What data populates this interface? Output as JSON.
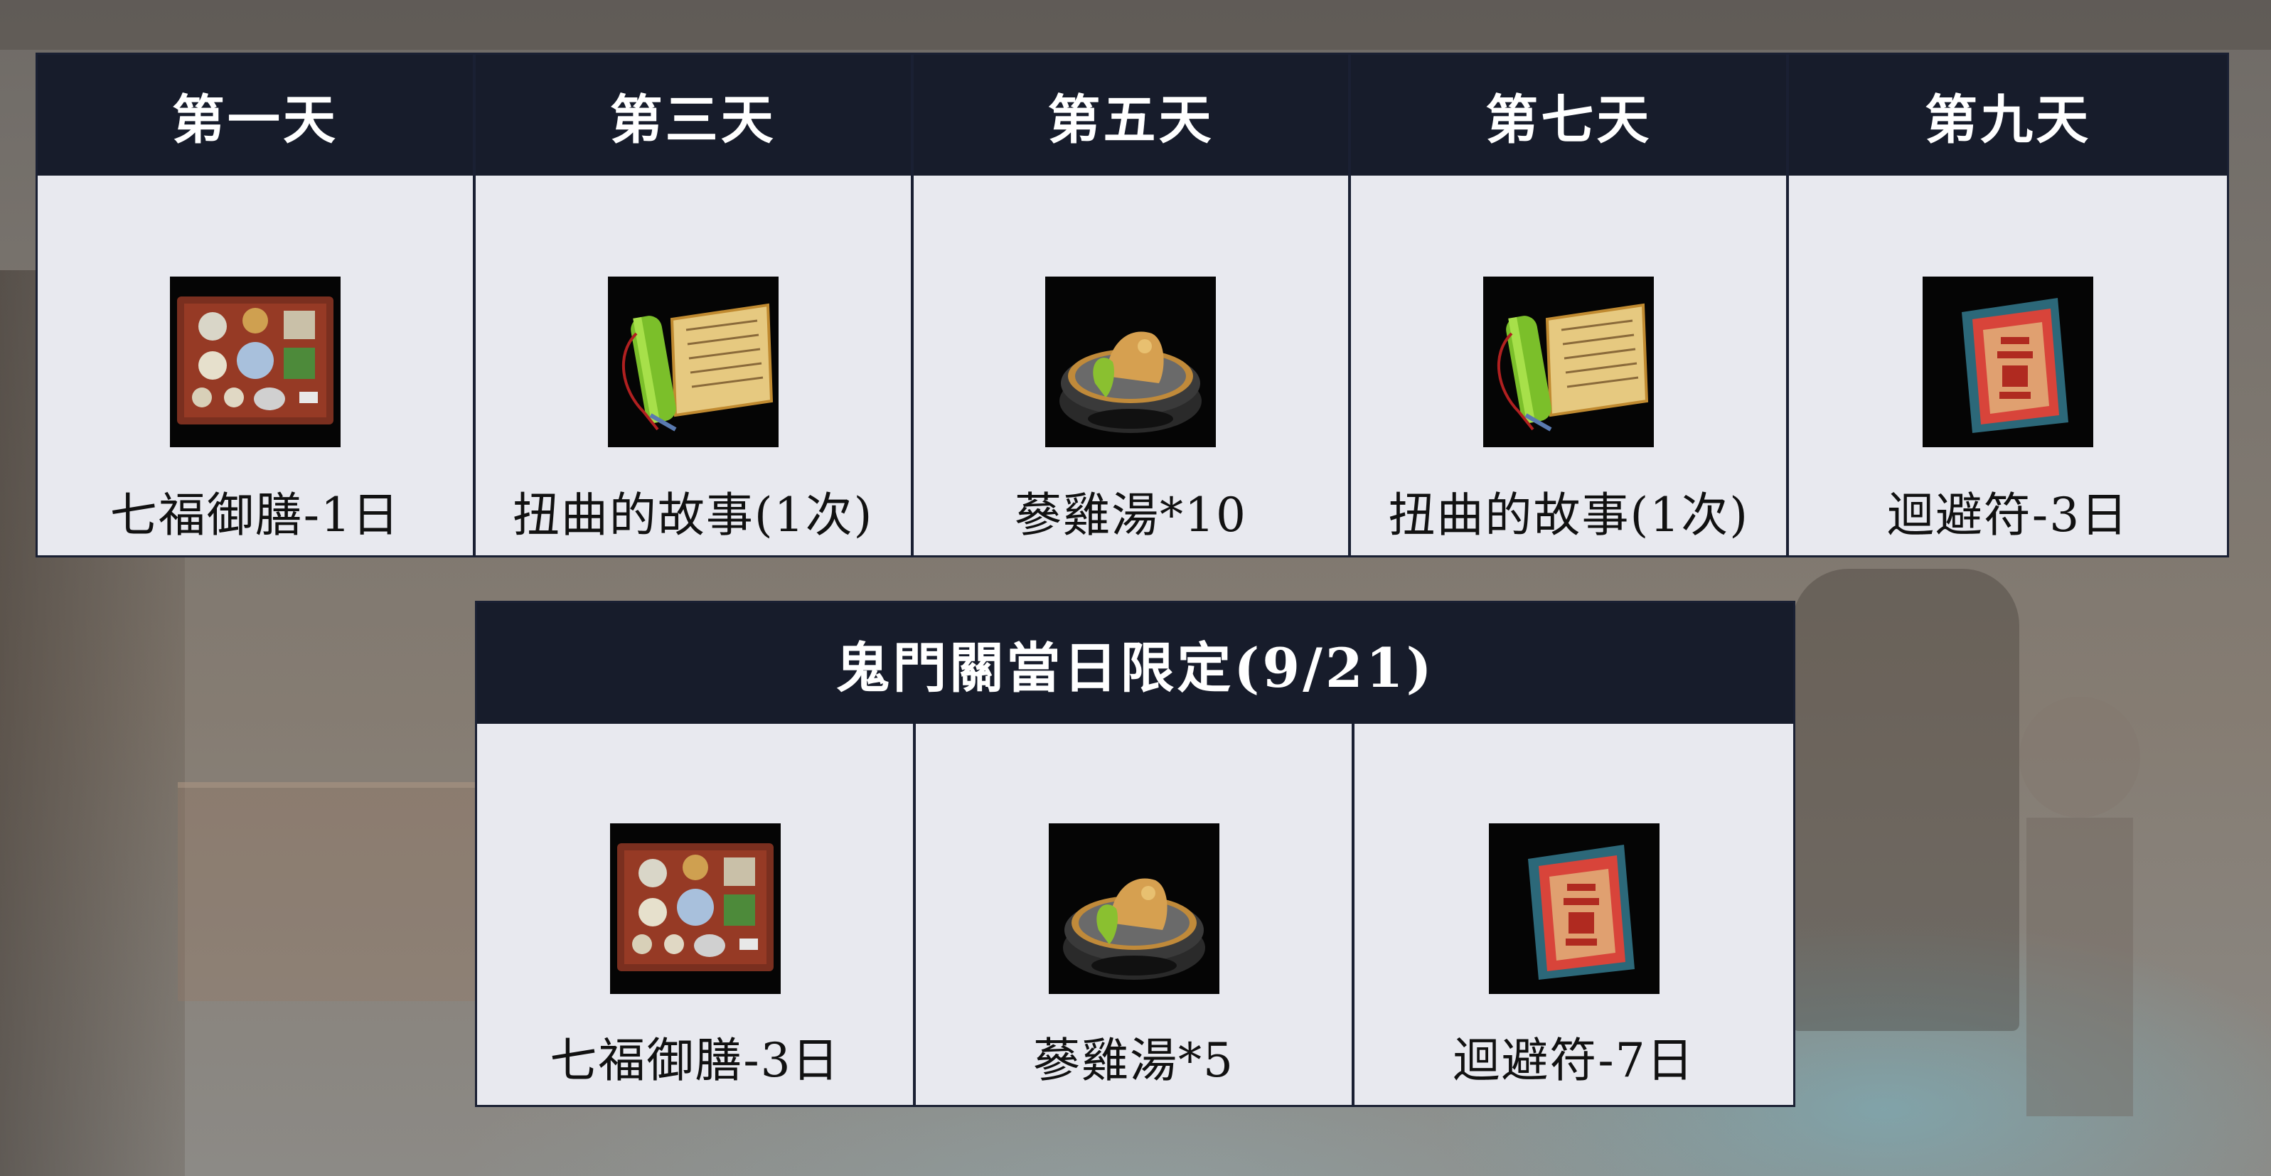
{
  "day_rewards": [
    {
      "day": "第一天",
      "item": "七福御膳-1日",
      "icon": "feast-tray-icon"
    },
    {
      "day": "第三天",
      "item": "扭曲的故事(1次)",
      "icon": "scroll-icon"
    },
    {
      "day": "第五天",
      "item": "蔘雞湯*10",
      "icon": "ginseng-chicken-soup-icon"
    },
    {
      "day": "第七天",
      "item": "扭曲的故事(1次)",
      "icon": "scroll-icon"
    },
    {
      "day": "第九天",
      "item": "迴避符-3日",
      "icon": "talisman-icon"
    }
  ],
  "special": {
    "title": "鬼門關當日限定(9/21)",
    "rewards": [
      {
        "item": "七福御膳-3日",
        "icon": "feast-tray-icon"
      },
      {
        "item": "蔘雞湯*5",
        "icon": "ginseng-chicken-soup-icon"
      },
      {
        "item": "迴避符-7日",
        "icon": "talisman-icon"
      }
    ]
  },
  "colors": {
    "header_bg": "#171c2b",
    "cell_bg": "#e8e9ef",
    "border": "#1a2033"
  }
}
